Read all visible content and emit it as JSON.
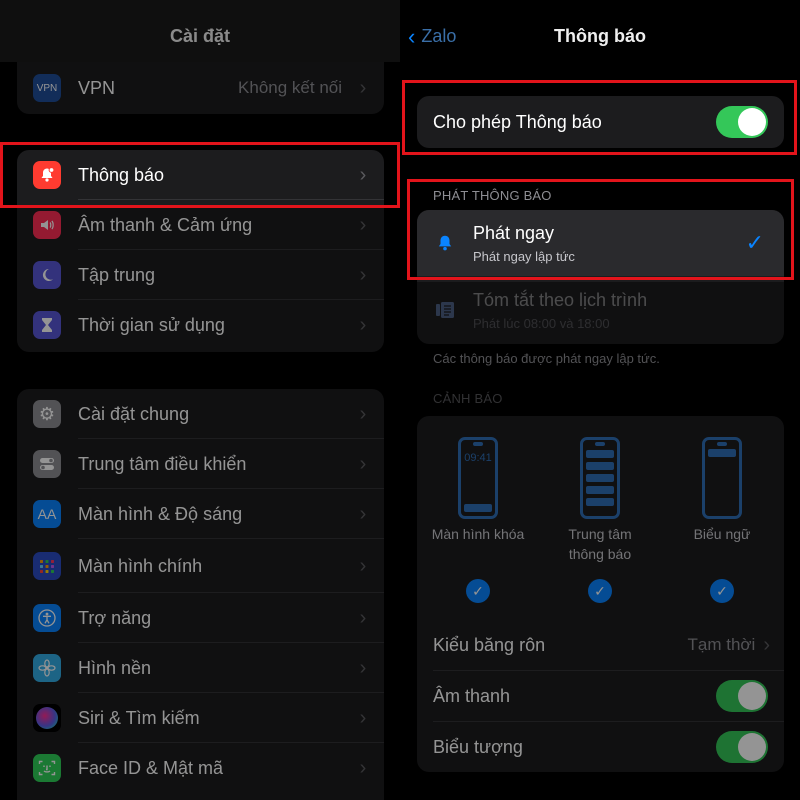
{
  "left": {
    "title": "Cài đặt",
    "vpn": {
      "label": "VPN",
      "icon_text": "VPN",
      "value": "Không kết nối"
    },
    "group1": [
      {
        "label": "Thông báo",
        "icon": "bell-badge-icon"
      },
      {
        "label": "Âm thanh & Cảm ứng",
        "icon": "speaker-icon"
      },
      {
        "label": "Tập trung",
        "icon": "moon-icon"
      },
      {
        "label": "Thời gian sử dụng",
        "icon": "hourglass-icon"
      }
    ],
    "group2": [
      {
        "label": "Cài đặt chung",
        "icon": "gear-icon"
      },
      {
        "label": "Trung tâm điều khiển",
        "icon": "switches-icon"
      },
      {
        "label": "Màn hình & Độ sáng",
        "icon": "display-brightness-icon",
        "icon_text": "AA"
      },
      {
        "label": "Màn hình chính",
        "icon": "home-screen-icon"
      },
      {
        "label": "Trợ năng",
        "icon": "accessibility-icon"
      },
      {
        "label": "Hình nền",
        "icon": "wallpaper-icon"
      },
      {
        "label": "Siri & Tìm kiếm",
        "icon": "siri-icon"
      },
      {
        "label": "Face ID & Mật mã",
        "icon": "face-id-icon"
      }
    ]
  },
  "right": {
    "back_label": "Zalo",
    "title": "Thông báo",
    "allow": {
      "label": "Cho phép Thông báo",
      "on": true
    },
    "delivery_header": "PHÁT THÔNG BÁO",
    "immediate": {
      "title": "Phát ngay",
      "subtitle": "Phát ngay lập tức",
      "selected": true
    },
    "scheduled": {
      "title": "Tóm tắt theo lịch trình",
      "subtitle": "Phát lúc 08:00 và 18:00"
    },
    "delivery_footnote": "Các thông báo được phát ngay lập tức.",
    "alerts_header": "CẢNH BÁO",
    "alert_styles": [
      {
        "label": "Màn hình khóa",
        "clock": "09:41",
        "checked": true
      },
      {
        "label": "Trung tâm thông báo",
        "checked": true
      },
      {
        "label": "Biểu ngữ",
        "checked": true
      }
    ],
    "banner_style": {
      "label": "Kiểu băng rôn",
      "value": "Tạm thời"
    },
    "sounds": {
      "label": "Âm thanh",
      "on": true
    },
    "badges": {
      "label": "Biểu tượng",
      "on": true
    }
  },
  "colors": {
    "accent": "#0a84ff",
    "toggle_on": "#34c759",
    "highlight": "#e3141b",
    "cell_bg": "#1c1c1e"
  }
}
